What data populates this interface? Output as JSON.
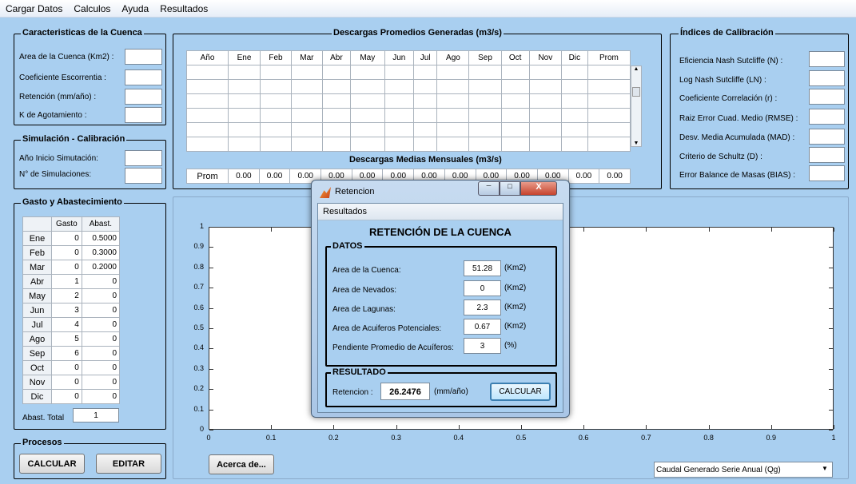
{
  "menu": [
    "Cargar Datos",
    "Calculos",
    "Ayuda",
    "Resultados"
  ],
  "cuenca": {
    "title": "Caracteristicas de la Cuenca",
    "fields": [
      "Area de la Cuenca (Km2) :",
      "Coeficiente Escorrentia :",
      "Retención (mm/año) :",
      "K de Agotamiento :"
    ]
  },
  "simulacion": {
    "title": "Simulación - Calibración",
    "fields": [
      "Año Inicio Simutación:",
      "N° de Simulaciones:"
    ]
  },
  "descargas": {
    "title": "Descargas Promedios Generadas (m3/s)",
    "headers": [
      "Año",
      "Ene",
      "Feb",
      "Mar",
      "Abr",
      "May",
      "Jun",
      "Jul",
      "Ago",
      "Sep",
      "Oct",
      "Nov",
      "Dic",
      "Prom"
    ],
    "subtitle": "Descargas Medias Mensuales (m3/s)",
    "prom_label": "Prom",
    "prom_values": [
      "0.00",
      "0.00",
      "0.00",
      "0.00",
      "0.00",
      "0.00",
      "0.00",
      "0.00",
      "0.00",
      "0.00",
      "0.00",
      "0.00",
      "0.00"
    ]
  },
  "indices": {
    "title": "Índices de Calibración",
    "fields": [
      "Eficiencia Nash Sutcliffe (N) :",
      "Log Nash Sutcliffe (LN) :",
      "Coeficiente Correlación (r) :",
      "Raiz Error Cuad. Medio (RMSE) :",
      "Desv. Media Acumulada (MAD) :",
      "Criterio de Schultz (D) :",
      "Error Balance de Masas (BIAS) :"
    ]
  },
  "gasto": {
    "title": "Gasto y Abastecimiento",
    "col1": "Gasto",
    "col2": "Abast.",
    "rows": [
      [
        "Ene",
        "0",
        "0.5000"
      ],
      [
        "Feb",
        "0",
        "0.3000"
      ],
      [
        "Mar",
        "0",
        "0.2000"
      ],
      [
        "Abr",
        "1",
        "0"
      ],
      [
        "May",
        "2",
        "0"
      ],
      [
        "Jun",
        "3",
        "0"
      ],
      [
        "Jul",
        "4",
        "0"
      ],
      [
        "Ago",
        "5",
        "0"
      ],
      [
        "Sep",
        "6",
        "0"
      ],
      [
        "Oct",
        "0",
        "0"
      ],
      [
        "Nov",
        "0",
        "0"
      ],
      [
        "Dic",
        "0",
        "0"
      ]
    ],
    "total_label": "Abast. Total",
    "total_value": "1"
  },
  "procesos": {
    "title": "Procesos",
    "calcular": "CALCULAR",
    "editar": "EDITAR"
  },
  "acerca": "Acerca de...",
  "select": {
    "value": "Caudal Generado Serie Anual (Qg)"
  },
  "plot": {
    "yticks": [
      "1",
      "0.9",
      "0.8",
      "0.7",
      "0.6",
      "0.5",
      "0.4",
      "0.3",
      "0.2",
      "0.1",
      "0"
    ],
    "xticks": [
      "0",
      "0.1",
      "0.2",
      "0.3",
      "0.4",
      "0.5",
      "0.6",
      "0.7",
      "0.8",
      "0.9",
      "1"
    ]
  },
  "dialog": {
    "title": "Retencion",
    "menu": "Resultados",
    "heading": "RETENCIÓN DE LA CUENCA",
    "datos": "DATOS",
    "fields": [
      [
        "Area de la Cuenca:",
        "51.28",
        "(Km2)"
      ],
      [
        "Area de Nevados:",
        "0",
        "(Km2)"
      ],
      [
        "Area de Lagunas:",
        "2.3",
        "(Km2)"
      ],
      [
        "Area de Acuiferos Potenciales:",
        "0.67",
        "(Km2)"
      ],
      [
        "Pendiente Promedio de Acuíferos:",
        "3",
        "(%)"
      ]
    ],
    "resultado": "RESULTADO",
    "ret_label": "Retencion :",
    "ret_value": "26.2476",
    "ret_unit": "(mm/año)",
    "calcular": "CALCULAR"
  }
}
